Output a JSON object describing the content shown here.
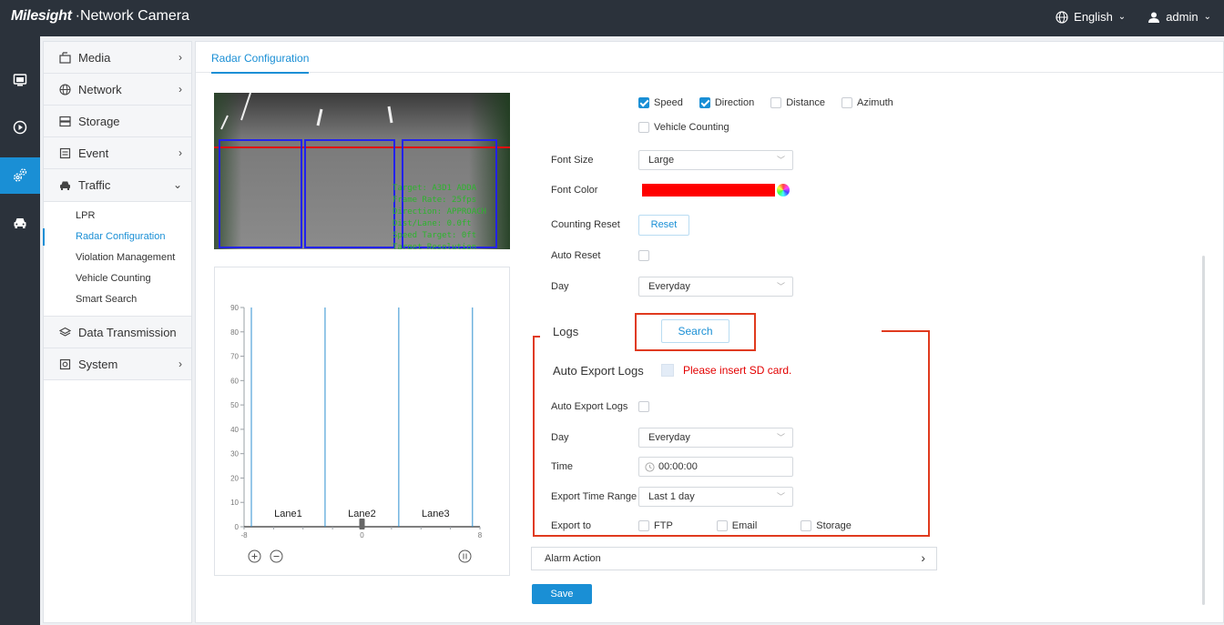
{
  "header": {
    "logo": "Milesight",
    "product": "·Network Camera",
    "language": "English",
    "user": "admin"
  },
  "rail": {
    "items": [
      "monitor-icon",
      "playback-icon",
      "settings-icon",
      "vehicle-icon"
    ],
    "active_index": 2
  },
  "sidebar": {
    "items": [
      {
        "label": "Media",
        "icon": "media-icon",
        "chevron": "›"
      },
      {
        "label": "Network",
        "icon": "globe-icon",
        "chevron": "›"
      },
      {
        "label": "Storage",
        "icon": "storage-icon"
      },
      {
        "label": "Event",
        "icon": "event-icon",
        "chevron": "›"
      },
      {
        "label": "Traffic",
        "icon": "car-icon",
        "chevron": "⌄"
      },
      {
        "label": "Data Transmission",
        "icon": "layers-icon"
      },
      {
        "label": "System",
        "icon": "system-icon",
        "chevron": "›"
      }
    ],
    "traffic_sub": [
      "LPR",
      "Radar Configuration",
      "Violation Management",
      "Vehicle Counting",
      "Smart Search"
    ],
    "active_sub": "Radar Configuration"
  },
  "tab": {
    "label": "Radar Configuration"
  },
  "video": {
    "osd_lines": [
      "Target: A3D1 ADDA",
      "Frame Rate: 25fps",
      "Direction: APPROACH",
      "Dist/Lane: 0.0ft",
      "Speed Target: 0ft",
      "Target Resolution"
    ]
  },
  "radar_chart": {
    "type": "line",
    "y_ticks": [
      "90",
      "80",
      "70",
      "60",
      "50",
      "40",
      "30",
      "20",
      "10",
      "0"
    ],
    "x_ticks": [
      "-8",
      "0",
      "8"
    ],
    "lanes": [
      "Lane1",
      "Lane2",
      "Lane3"
    ],
    "ylim": [
      0,
      90
    ],
    "xlim": [
      -8,
      8
    ]
  },
  "form": {
    "overlay_options": [
      {
        "label": "Speed",
        "checked": true
      },
      {
        "label": "Direction",
        "checked": true
      },
      {
        "label": "Distance",
        "checked": false
      },
      {
        "label": "Azimuth",
        "checked": false
      },
      {
        "label": "Vehicle Counting",
        "checked": false
      }
    ],
    "font_size": {
      "label": "Font Size",
      "value": "Large"
    },
    "font_color": {
      "label": "Font Color",
      "value": "#ff0000"
    },
    "counting_reset": {
      "label": "Counting Reset",
      "button": "Reset"
    },
    "auto_reset": {
      "label": "Auto Reset",
      "checked": false
    },
    "day": {
      "label": "Day",
      "value": "Everyday"
    }
  },
  "logs": {
    "label": "Logs",
    "search_button": "Search",
    "auto_export_heading": "Auto Export Logs",
    "warning": "Please insert SD card.",
    "auto_export_label": "Auto Export Logs",
    "day_label": "Day",
    "day_value": "Everyday",
    "time_label": "Time",
    "time_value": "00:00:00",
    "range_label": "Export Time Range",
    "range_value": "Last 1 day",
    "export_to_label": "Export to",
    "export_targets": [
      "FTP",
      "Email",
      "Storage"
    ]
  },
  "alarm_action": {
    "label": "Alarm Action",
    "chevron": "›"
  },
  "save_button": "Save",
  "colors": {
    "accent": "#1a8fd5",
    "topbar": "#2b323b",
    "highlight_frame": "#e03a1e",
    "warning": "#e30000"
  }
}
